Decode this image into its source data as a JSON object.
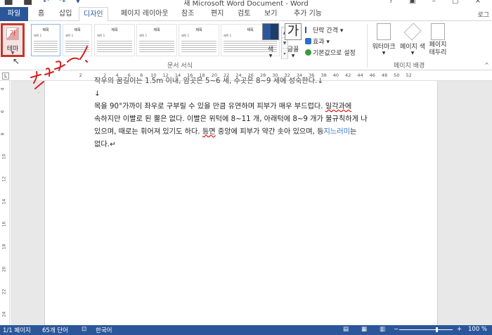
{
  "window": {
    "title": "새 Microsoft Word Document - Word",
    "quick_access": "⬛ ⬛ ↶ ↷ ▾",
    "controls": "? ▣ – ▢ ×"
  },
  "tabs": [
    {
      "label": "파일"
    },
    {
      "label": "홈"
    },
    {
      "label": "삽입"
    },
    {
      "label": "디자인"
    },
    {
      "label": "페이지 레이아웃"
    },
    {
      "label": "참조"
    },
    {
      "label": "편지"
    },
    {
      "label": "검토"
    },
    {
      "label": "보기"
    },
    {
      "label": "추가 기능"
    }
  ],
  "active_tab": "디자인",
  "user_label": "로그",
  "ribbon": {
    "theme_button": {
      "label": "테마",
      "icon_text": "가"
    },
    "gallery": [
      {
        "heading": "제목",
        "sub": "제목 1"
      },
      {
        "heading": "제목",
        "sub": "제목 1"
      },
      {
        "heading": "제목",
        "sub": "제목 1"
      },
      {
        "heading": "제목",
        "sub": "제목 1"
      },
      {
        "heading": "제목",
        "sub": "제목 1"
      },
      {
        "heading": "제목",
        "sub": "제목 1"
      },
      {
        "heading": "제목",
        "sub": "제목 1"
      }
    ],
    "colors_label": "색",
    "fonts_label": "글꼴",
    "fonts_icon": "가",
    "paragraph_spacing_label": "단락 간격 ▾",
    "effects_label": "효과 ▾",
    "set_default_label": "기본값으로 설정",
    "watermark_label": "워터마크",
    "page_color_label": "페이지 색",
    "page_border_label": "페이지 테두리",
    "group_document_format": "문서 서식",
    "group_page_background": "페이지 배경"
  },
  "ruler": {
    "corner": "L",
    "ticks": [
      "2",
      "",
      "2",
      "4",
      "6",
      "8",
      "10",
      "12",
      "14",
      "16",
      "18",
      "20",
      "22",
      "24",
      "26",
      "28",
      "30",
      "32",
      "34",
      "36",
      "38",
      "40",
      "42",
      "44",
      "46",
      "48",
      "50",
      "52"
    ],
    "vticks": [
      "4",
      "6",
      "8",
      "10",
      "12",
      "14",
      "16",
      "18",
      "20",
      "22",
      "24"
    ]
  },
  "document": {
    "line0": "작우의 꿈길이는 1.5m 이내, 암곳은 5~6 세, 수곳은 8~9 세에 성숙한다.↓",
    "line1": "↓",
    "line2a": "목을 90°가까이 좌우로 구부릴 수 있을 만큼 유연하며 피부가 매우 부드럽다. ",
    "line2b": "일각과에",
    "line3": "속하지만 이빨로 된 뿔은 없다. 이빨은 위턱에 8~11 개, 아래턱에 8~9 개가 불규칙하게 나",
    "line4a": "있으며, 때로는 휘어져 있기도 하다. ",
    "line4b": "등면",
    "line4c": " 중앙에 피부가 약간 솟아 있으며, 등",
    "line4d": "지느러미",
    "line4e": "는",
    "line5": "없다.↵"
  },
  "annotation": {
    "text": "클릭~!",
    "color": "#d21f1f"
  },
  "status": {
    "page": "1/1 페이지",
    "words": "65개 단어",
    "lang": "한국어",
    "zoom_minus": "−",
    "zoom_plus": "+",
    "zoom": "100 %"
  }
}
